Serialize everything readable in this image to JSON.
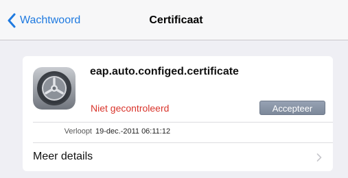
{
  "navbar": {
    "back_label": "Wachtwoord",
    "title": "Certificaat"
  },
  "certificate": {
    "name": "eap.auto.configed.certificate",
    "status": "Niet gecontroleerd",
    "accept_label": "Accepteer",
    "expires_label": "Verloopt",
    "expires_value": "19-dec.-2011 06:11:12",
    "details_label": "Meer details",
    "icon": "settings-gear-icon"
  },
  "colors": {
    "accent": "#1f7ae0",
    "status_warning": "#d9342b",
    "accept_button": "#8793a6",
    "background": "#efeff4"
  }
}
